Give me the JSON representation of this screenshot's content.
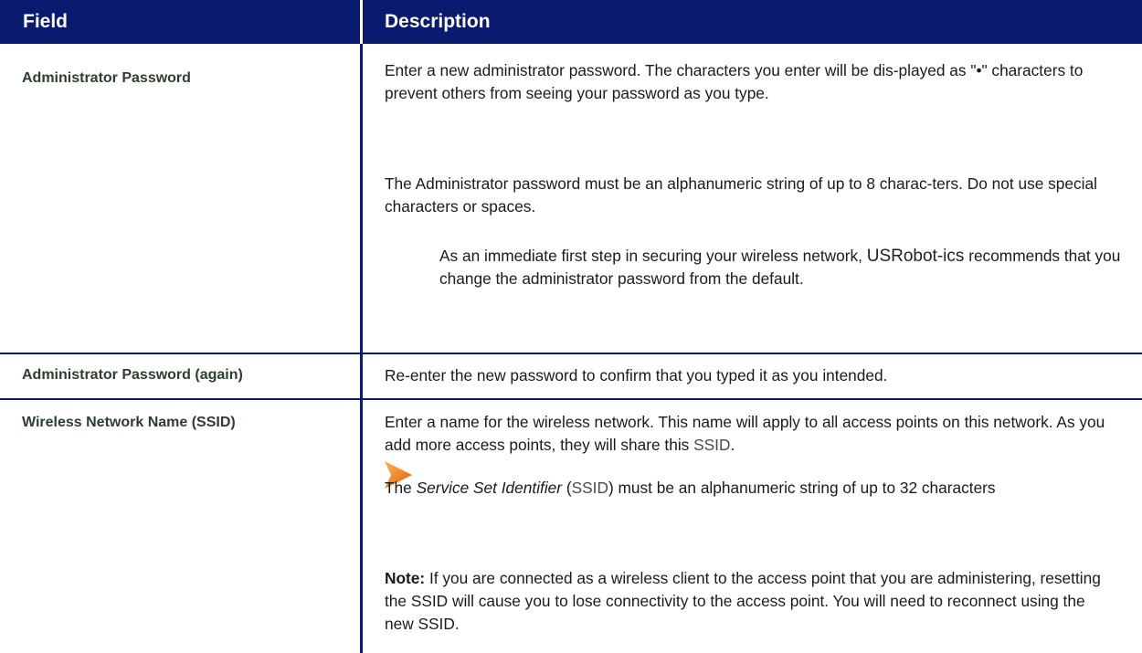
{
  "table": {
    "header": {
      "field": "Field",
      "description": "Description"
    },
    "rows": [
      {
        "field": "Administrator Password",
        "p1": "Enter a new administrator password. The characters you enter will be dis-played as \"•\" characters to prevent others from seeing your password as you type.",
        "p2": "The Administrator password must be an alphanumeric string of up to 8 charac-ters. Do not use special characters or spaces.",
        "tip_before": "As an immediate first step in securing your wireless network, ",
        "tip_brand": "USRobot-ics",
        "tip_after": " recommends that you change the administrator password from the default."
      },
      {
        "field": "Administrator Password (again)",
        "p1": "Re-enter the new password to confirm that you typed it as you intended."
      },
      {
        "field": "Wireless Network Name (SSID)",
        "p1_before": "Enter a name for the wireless network. This name will apply to all access points on this network. As you add more access points, they will share this ",
        "p1_link": "SSID",
        "p1_after": ".",
        "p2_italic": "Service Set Identifier",
        "p2_before": "The ",
        "p2_link": "SSID",
        "p2_after": " must be an alphanumeric string of up to 32 characters",
        "note_label": "Note:",
        "note_text": " If you are connected as a wireless client to the access point that you are administering, resetting the SSID will cause you to lose connectivity to the access point. You will need to reconnect using the new SSID."
      }
    ]
  },
  "colors": {
    "header_bg": "#0a1a6e",
    "border": "#0a1a6e",
    "arrow": "#f07a14"
  },
  "icons": {
    "tip": "orange-arrow-icon"
  }
}
